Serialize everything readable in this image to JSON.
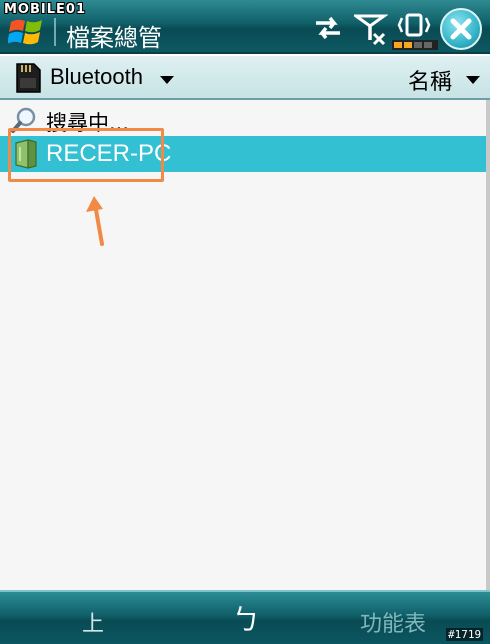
{
  "watermark": "MOBILE01",
  "titlebar": {
    "title": "檔案總管",
    "status_icons": [
      "sync-arrows-icon",
      "no-signal-icon",
      "vibrate-icon",
      "battery-icon"
    ],
    "close_icon": "close-icon"
  },
  "header": {
    "storage_icon": "sd-card-icon",
    "folder": "Bluetooth",
    "sort_label": "名稱"
  },
  "list": {
    "searching_label": "搜尋中...",
    "items": [
      {
        "label": "RECER-PC",
        "icon": "bluetooth-device-icon",
        "selected": true
      }
    ]
  },
  "softkeys": {
    "left": "上",
    "center": "ㄅ",
    "right": "功能表"
  },
  "image_id": "#1719",
  "colors": {
    "titlebar": "#0f5f68",
    "selection": "#33c0d2",
    "annotation": "#f08a46"
  }
}
